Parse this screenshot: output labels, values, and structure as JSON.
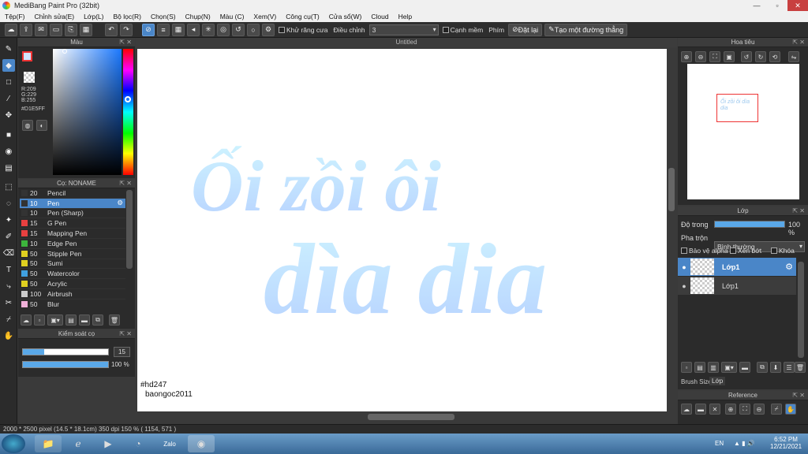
{
  "app": {
    "title": "MediBang Paint Pro (32bit)"
  },
  "menu": [
    "Tệp(F)",
    "Chỉnh sửa(E)",
    "Lớp(L)",
    "Bộ lọc(R)",
    "Chọn(S)",
    "Chụp(N)",
    "Màu (C)",
    "Xem(V)",
    "Công cụ(T)",
    "Cửa sổ(W)",
    "Cloud",
    "Help"
  ],
  "toolbar": {
    "antialias_label": "Khử răng cưa",
    "adjust_label": "Điều chỉnh",
    "adjust_value": "3",
    "snap_label": "Cạnh mềm",
    "key_label": "Phím",
    "reset_label": "Đặt lại",
    "straight_label": "Tạo một đường thẳng"
  },
  "color_panel": {
    "title": "Màu",
    "r": "R:209",
    "g": "G:229",
    "b": "B:255",
    "hex": "#D1E5FF",
    "primary_color": "#D1E5FF"
  },
  "brush_panel": {
    "title": "Cọ: NONAME",
    "brushes": [
      {
        "size": "20",
        "name": "Pencil",
        "color": "#333333"
      },
      {
        "size": "10",
        "name": "Pen",
        "color": "#333333"
      },
      {
        "size": "10",
        "name": "Pen (Sharp)",
        "color": "#333333"
      },
      {
        "size": "15",
        "name": "G Pen",
        "color": "#e84040"
      },
      {
        "size": "15",
        "name": "Mapping Pen",
        "color": "#e84040"
      },
      {
        "size": "10",
        "name": "Edge Pen",
        "color": "#3cb43c"
      },
      {
        "size": "50",
        "name": "Stipple Pen",
        "color": "#e0d020"
      },
      {
        "size": "50",
        "name": "Sumi",
        "color": "#e0d020"
      },
      {
        "size": "50",
        "name": "Watercolor",
        "color": "#40a0e0"
      },
      {
        "size": "50",
        "name": "Acrylic",
        "color": "#e0d020"
      },
      {
        "size": "100",
        "name": "Airbrush",
        "color": "#cccccc"
      },
      {
        "size": "50",
        "name": "Blur",
        "color": "#f0b0d8"
      }
    ],
    "selected_index": 1
  },
  "control_panel": {
    "title": "Kiểm soát cọ",
    "size_value": "15",
    "opacity_value": "100 %",
    "size_fraction": 0.25,
    "opacity_fraction": 1.0
  },
  "canvas": {
    "tab_title": "Untitled",
    "line1": "Ối zồi ôi",
    "line2": "dìa dia",
    "text_color": "#cfe6ff",
    "watermark1": "#hd247",
    "watermark2": "baongoc2011"
  },
  "navigator": {
    "title": "Hoa tiêu",
    "preview_text": "Ối zồi ôi dìa dia"
  },
  "layer_panel": {
    "title": "Lớp",
    "opacity_label": "Độ trong",
    "opacity_value": "100 %",
    "opacity_fraction": 1.0,
    "blend_label": "Pha trộn",
    "blend_value": "Bình thường",
    "protect_alpha": "Bảo vệ alpha",
    "clipping": "Xén bớt",
    "lock": "Khóa",
    "layers": [
      {
        "name": "Lớp1",
        "selected": true
      },
      {
        "name": "Lớp1",
        "selected": false
      }
    ],
    "tabs": [
      "Brush Size",
      "Lớp"
    ]
  },
  "reference_panel": {
    "title": "Reference"
  },
  "status": {
    "text": "2000 * 2500 pixel   (14.5 * 18.1cm)   350 dpi   150 %   ( 1154, 571 )"
  },
  "taskbar": {
    "lang": "EN",
    "time": "6:52 PM",
    "date": "12/21/2021",
    "zalo": "Zalo"
  }
}
